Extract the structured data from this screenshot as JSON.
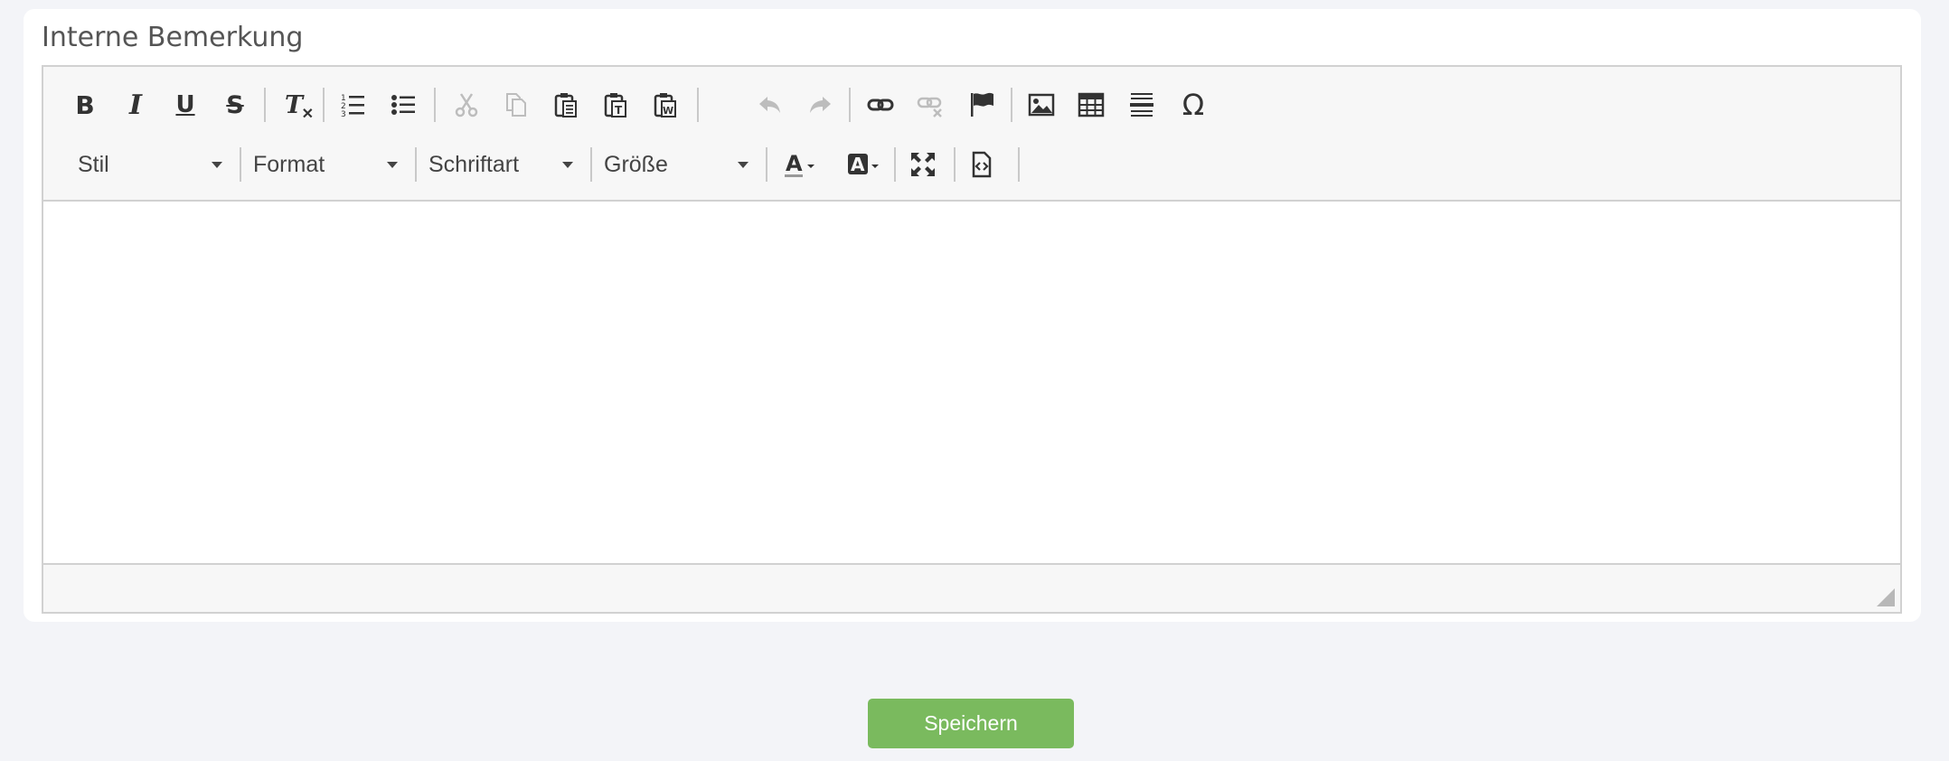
{
  "section": {
    "title": "Interne Bemerkung"
  },
  "toolbar": {
    "combos": {
      "style": "Stil",
      "format": "Format",
      "font": "Schriftart",
      "size": "Größe"
    },
    "icons": [
      "bold-icon",
      "italic-icon",
      "underline-icon",
      "strikethrough-icon",
      "remove-format-icon",
      "numbered-list-icon",
      "bulleted-list-icon",
      "cut-icon",
      "copy-icon",
      "paste-icon",
      "paste-text-icon",
      "paste-word-icon",
      "undo-icon",
      "redo-icon",
      "link-icon",
      "unlink-icon",
      "anchor-icon",
      "image-icon",
      "table-icon",
      "horizontal-line-icon",
      "special-char-icon",
      "text-color-icon",
      "background-color-icon",
      "maximize-icon",
      "source-icon"
    ]
  },
  "editor": {
    "content": ""
  },
  "actions": {
    "save_label": "Speichern"
  },
  "colors": {
    "accent_green": "#7aba5e",
    "background": "#f3f4f8",
    "toolbar_bg": "#f7f7f7"
  }
}
